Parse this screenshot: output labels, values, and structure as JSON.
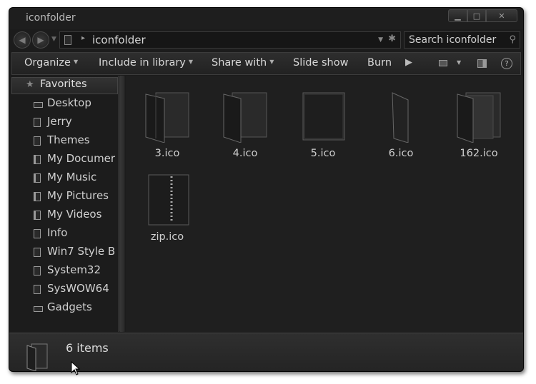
{
  "window": {
    "title": "iconfolder"
  },
  "caption_buttons": {
    "minimize": "▁",
    "maximize": "□",
    "close": "✕"
  },
  "navigation": {
    "back": "◀",
    "forward": "▶",
    "recent_dropdown": "▼"
  },
  "address_bar": {
    "separator": "▸",
    "location": "iconfolder",
    "dropdown": "▼",
    "refresh": "✱"
  },
  "search": {
    "placeholder": "Search iconfolder",
    "icon": "⚲"
  },
  "toolbar": {
    "organize": "Organize",
    "include_in_library": "Include in library",
    "share_with": "Share with",
    "slide_show": "Slide show",
    "burn": "Burn",
    "more": "▶",
    "dropdown_arrow": "▼",
    "help": "?"
  },
  "nav_pane": {
    "favorites": "Favorites",
    "favorites_icon": "★",
    "items": [
      {
        "label": "Desktop",
        "icon": "desktop-folder-icon"
      },
      {
        "label": "Jerry",
        "icon": "user-folder-icon"
      },
      {
        "label": "Themes",
        "icon": "folder-icon"
      },
      {
        "label": "My Documer",
        "icon": "documents-library-icon"
      },
      {
        "label": "My Music",
        "icon": "music-library-icon"
      },
      {
        "label": "My Pictures",
        "icon": "pictures-library-icon"
      },
      {
        "label": "My Videos",
        "icon": "videos-library-icon"
      },
      {
        "label": "Info",
        "icon": "folder-icon"
      },
      {
        "label": "Win7 Style B",
        "icon": "folder-icon"
      },
      {
        "label": "System32",
        "icon": "folder-icon"
      },
      {
        "label": "SysWOW64",
        "icon": "folder-icon"
      },
      {
        "label": "Gadgets",
        "icon": "gadgets-folder-icon"
      }
    ]
  },
  "files": [
    {
      "name": "3.ico",
      "icon": "open-folder-icon"
    },
    {
      "name": "4.ico",
      "icon": "open-folder-icon"
    },
    {
      "name": "5.ico",
      "icon": "closed-folder-icon"
    },
    {
      "name": "6.ico",
      "icon": "folder-side-view-icon"
    },
    {
      "name": "162.ico",
      "icon": "open-folder-with-papers-icon"
    },
    {
      "name": "zip.ico",
      "icon": "zip-folder-icon"
    }
  ],
  "status_bar": {
    "item_count": "6 items"
  }
}
